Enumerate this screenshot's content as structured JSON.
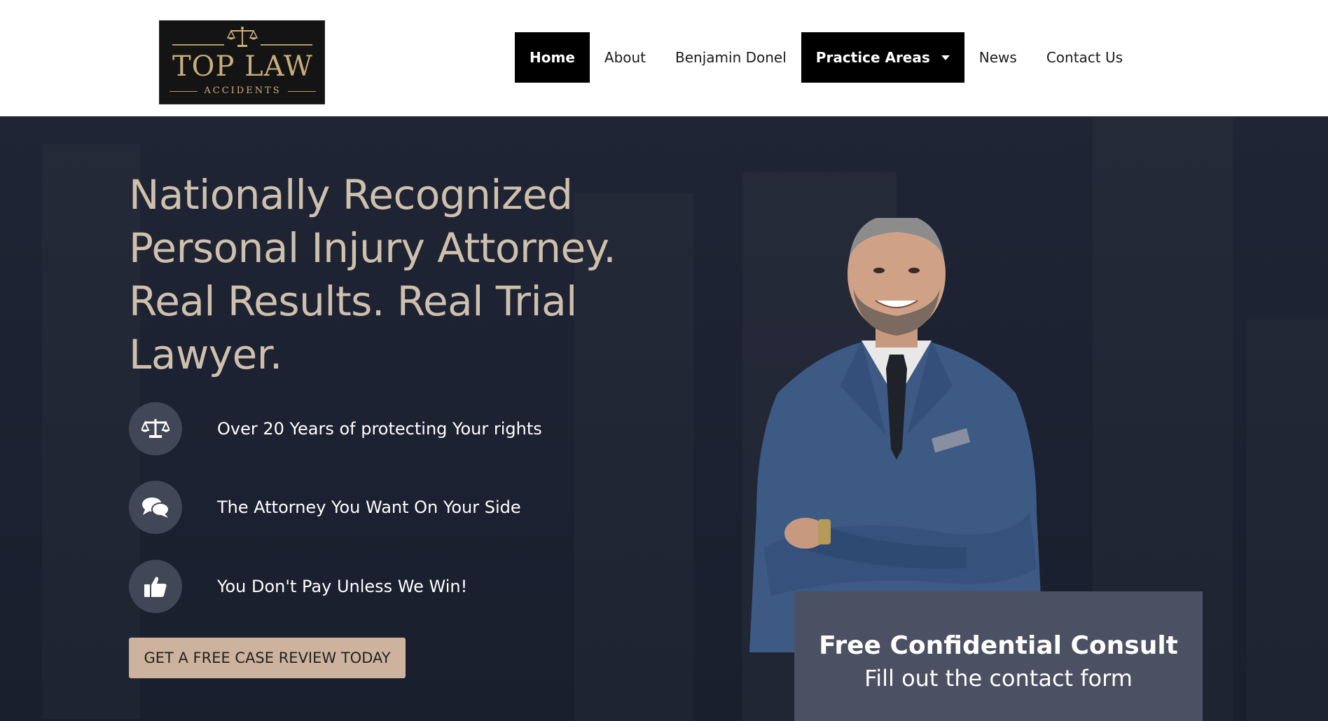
{
  "header": {
    "logo": {
      "brand": "TOP LAW",
      "subtitle": "ACCIDENTS",
      "icon": "scales-of-justice-icon",
      "brand_color": "#c9ad7c"
    },
    "nav": [
      {
        "label": "Home",
        "active": true
      },
      {
        "label": "About"
      },
      {
        "label": "Benjamin Donel"
      },
      {
        "label": "Practice Areas",
        "has_dropdown": true
      },
      {
        "label": "News"
      },
      {
        "label": "Contact Us"
      }
    ]
  },
  "hero": {
    "headline": "Nationally Recognized Personal Injury Attorney. Real Results. Real Trial Lawyer.",
    "features": [
      {
        "icon": "scales-icon",
        "text": "Over 20 Years of protecting Your rights"
      },
      {
        "icon": "chat-bubbles-icon",
        "text": "The Attorney You Want On Your Side"
      },
      {
        "icon": "thumbs-up-icon",
        "text": "You Don't Pay Unless We Win!"
      }
    ],
    "cta_label": "GET A FREE CASE REVIEW TODAY",
    "consult": {
      "title": "Free Confidential Consult",
      "subtitle": "Fill out the contact form"
    },
    "colors": {
      "background": "#1c2230",
      "headline": "#cfc0ad",
      "cta": "#cdb39d",
      "consult_box": "#4b5062",
      "icon_circle": "#414756"
    }
  }
}
